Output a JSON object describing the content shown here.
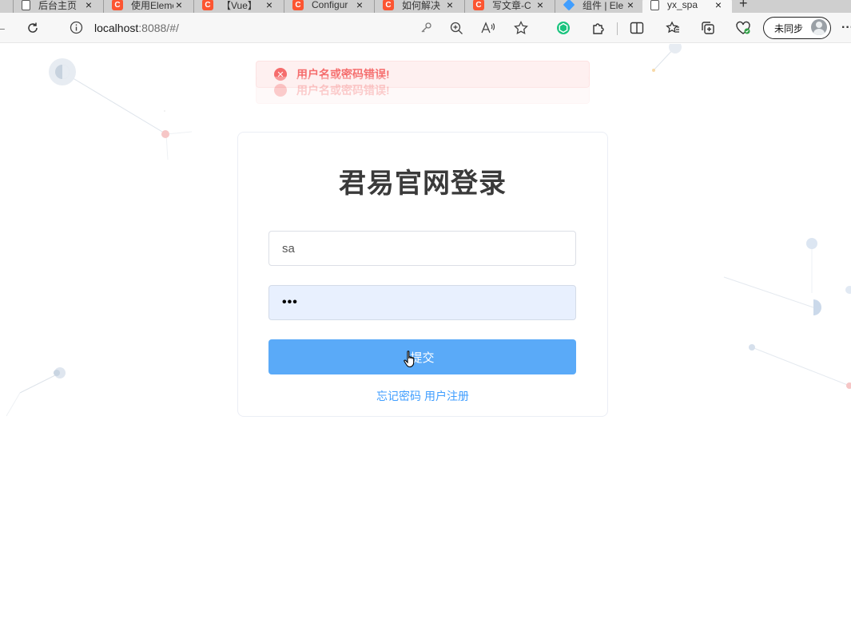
{
  "browser": {
    "tabs": [
      {
        "title": "后台主页",
        "favicon": "page-icon"
      },
      {
        "title": "使用Element",
        "favicon": "csdn-icon"
      },
      {
        "title": "【Vue】",
        "favicon": "csdn-icon"
      },
      {
        "title": "Configur",
        "favicon": "csdn-icon"
      },
      {
        "title": "如何解决",
        "favicon": "csdn-icon"
      },
      {
        "title": "写文章-C",
        "favicon": "csdn-icon"
      },
      {
        "title": "组件 | Ele",
        "favicon": "element-icon"
      },
      {
        "title": "yx_spa",
        "favicon": "page-icon",
        "active": true
      }
    ],
    "url_host": "localhost",
    "url_rest": ":8088/#/",
    "sync_label": "未同步",
    "accent": "#fc5531"
  },
  "messages": [
    {
      "text": "用户名或密码错误!"
    },
    {
      "text": "用户名或密码错误!"
    }
  ],
  "login": {
    "title": "君易官网登录",
    "username_value": "sa",
    "password_value": "•••",
    "submit_label": "提交",
    "forgot_link": "忘记密码",
    "register_link": "用户注册"
  },
  "colors": {
    "error": "#f56c6c",
    "primary_button": "#5aaaf8",
    "link": "#409eff"
  }
}
